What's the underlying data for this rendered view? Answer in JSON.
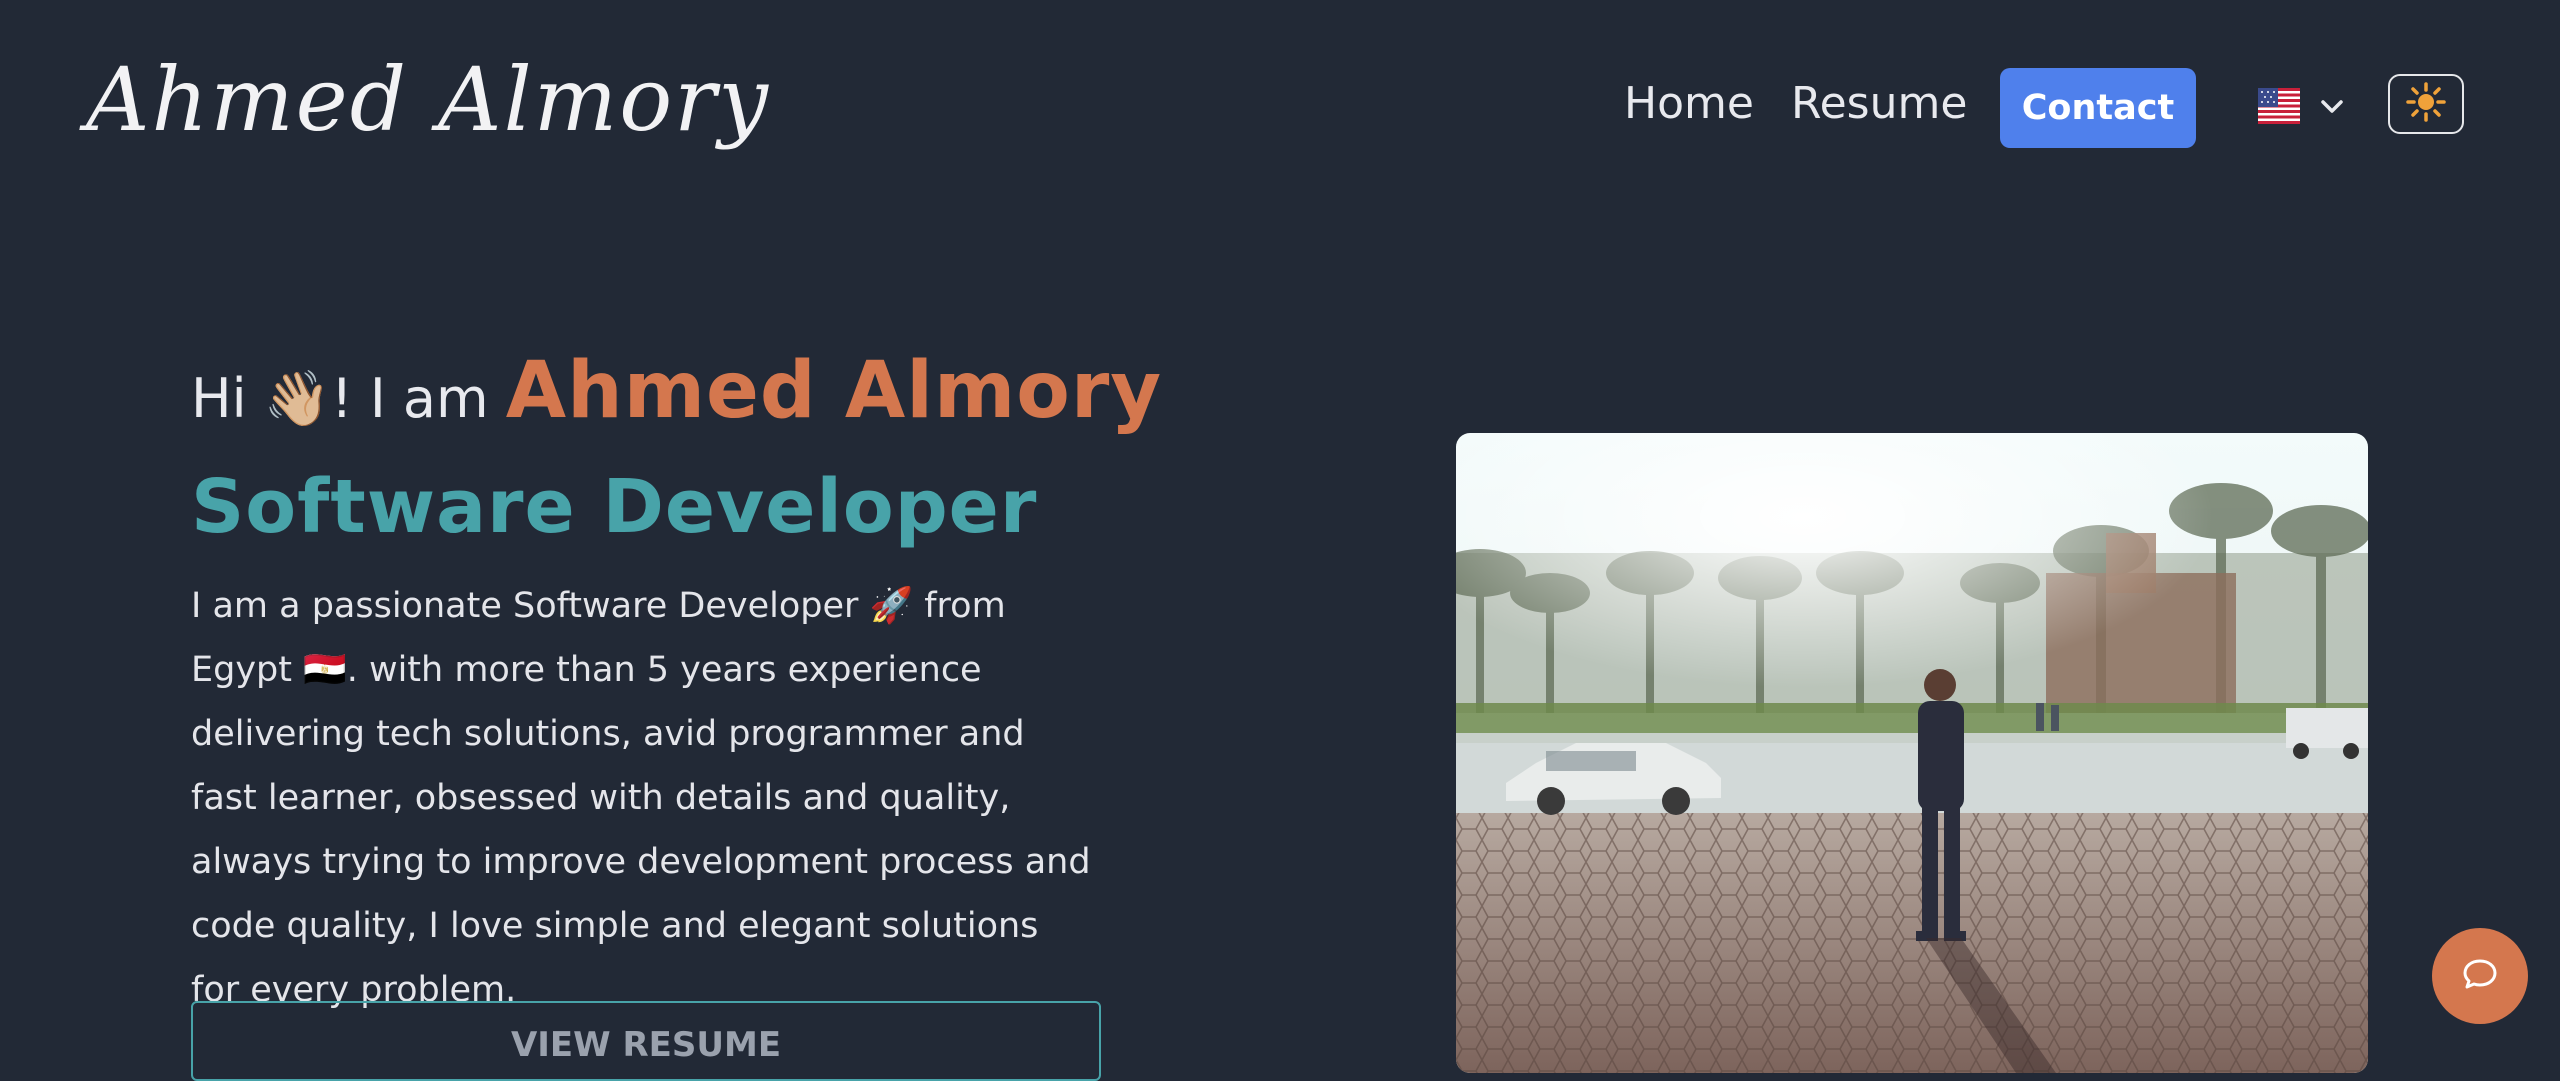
{
  "header": {
    "logo_text": "Ahmed Almory",
    "nav": [
      {
        "label": "Home"
      },
      {
        "label": "Resume"
      }
    ],
    "contact_label": "Contact",
    "language": {
      "flag_icon": "us-flag-icon",
      "chevron_icon": "chevron-down-icon"
    },
    "theme_icon": "sun-icon"
  },
  "hero": {
    "greeting_prefix": "Hi ",
    "wave_emoji": "👋🏼",
    "greeting_suffix": "! I am ",
    "name": "Ahmed Almory",
    "role": "Software Developer",
    "description": "I am a passionate Software Developer 🚀 from Egypt 🇪🇬. with more than 5 years experience delivering tech solutions, avid programmer and fast learner, obsessed with details and quality, always trying to improve development process and code quality, I love simple and elegant solutions for every problem.",
    "view_resume_label": "VIEW RESUME"
  },
  "chat": {
    "icon": "chat-bubble-icon"
  },
  "colors": {
    "background": "#222936",
    "accent_orange": "#d4774e",
    "accent_teal": "#48a3a9",
    "contact_blue": "#4f80ec"
  }
}
